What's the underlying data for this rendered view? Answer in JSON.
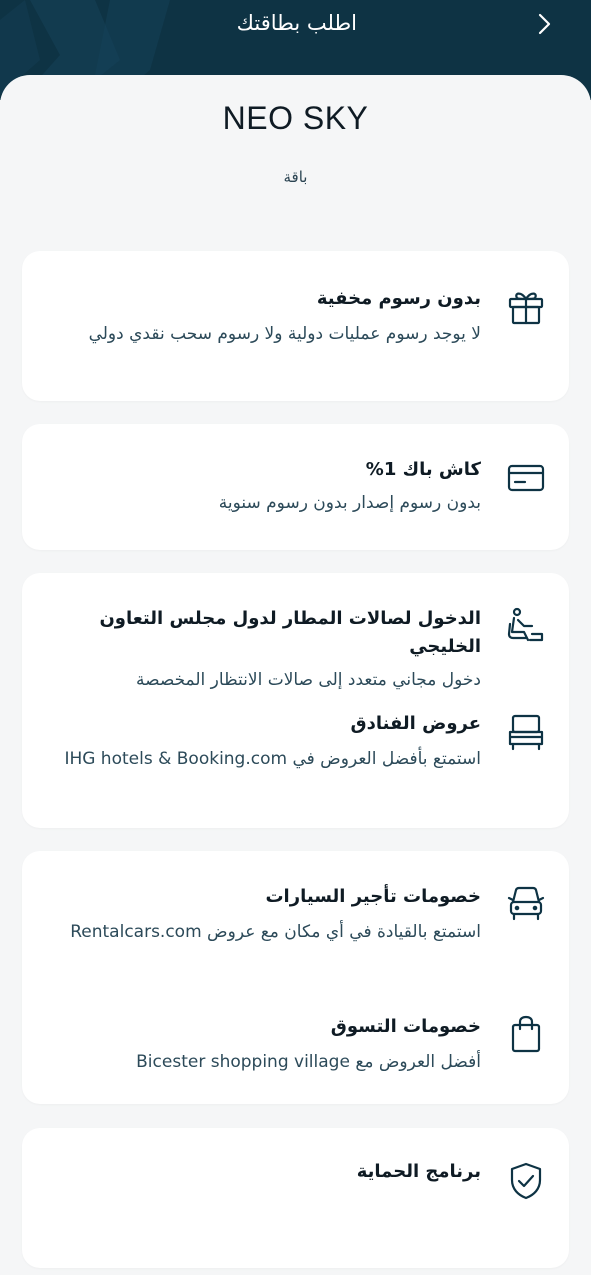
{
  "header": {
    "title": "اطلب بطاقتك",
    "back_icon": "chevron-right-icon",
    "background": "#0e3344"
  },
  "card": {
    "name": "NEO SKY",
    "type": "باقة"
  },
  "features": [
    {
      "icon": "gift-icon",
      "title": "بدون رسوم مخفية",
      "description": "لا يوجد رسوم عمليات دولية ولا رسوم سحب نقدي دولي"
    },
    {
      "icon": "credit-card-icon",
      "title": "كاش باك 1%",
      "description": "بدون رسوم إصدار بدون رسوم سنوية"
    },
    {
      "icon": "lounge-seat-icon",
      "title": "الدخول لصالات المطار لدول مجلس التعاون الخليجي",
      "description": "دخول مجاني متعدد إلى صالات الانتظار المخصصة"
    },
    {
      "icon": "bed-icon",
      "title": "عروض الفنادق",
      "description": "استمتع بأفضل العروض في IHG hotels & Booking.com"
    },
    {
      "icon": "car-icon",
      "title": "خصومات تأجير السيارات",
      "description": "استمتع بالقيادة في أي مكان مع عروض Rentalcars.com"
    },
    {
      "icon": "shopping-bag-icon",
      "title": "خصومات التسوق",
      "description": "أفضل العروض مع Bicester shopping village"
    },
    {
      "icon": "shield-check-icon",
      "title": "برنامج الحماية",
      "description": ""
    }
  ]
}
